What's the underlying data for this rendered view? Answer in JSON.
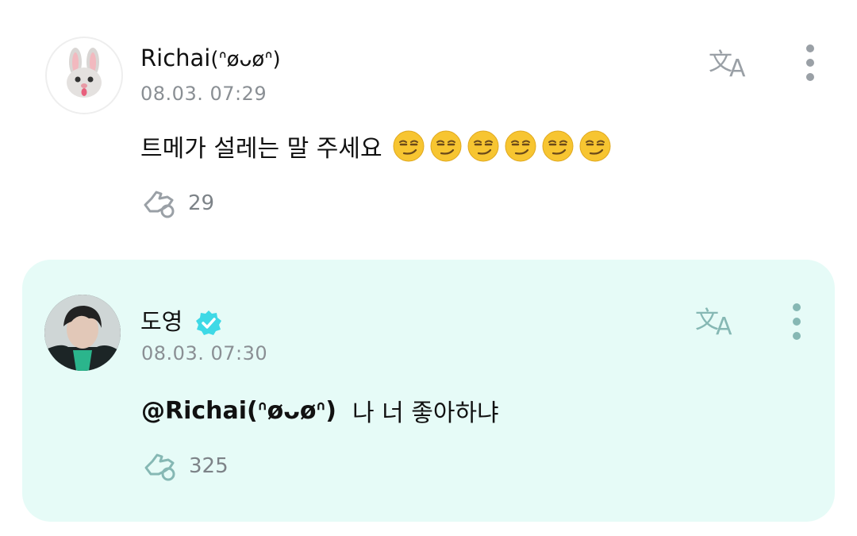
{
  "posts": [
    {
      "username": "Richai",
      "username_suffix": "(ᐢøᴗøᐢ)",
      "time": "08.03. 07:29",
      "message": "트메가 설레는 말 주세요",
      "emoji_count": 6,
      "emoji_icon": "smirking-face-icon",
      "likes": "29",
      "avatar_icon": "bunny-face-icon"
    },
    {
      "username": "도영",
      "verified": true,
      "time": "08.03. 07:30",
      "mention": "@Richai(ᐢøᴗøᐢ)",
      "message": "나 너 좋아하냐",
      "likes": "325",
      "avatar_icon": "profile-photo"
    }
  ],
  "colors": {
    "reply_bg": "#e6fbf7",
    "verified": "#3ed9e6",
    "icon_gray": "#9aa0a6",
    "reply_icon": "#86b8b4"
  }
}
